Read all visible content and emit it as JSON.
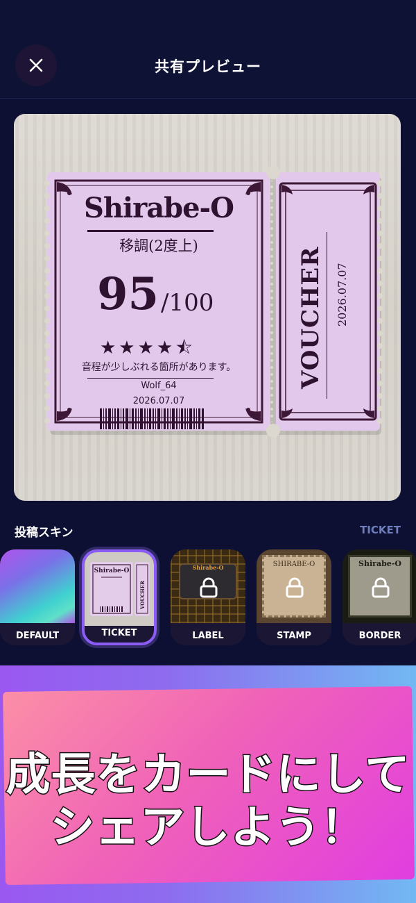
{
  "header": {
    "title": "共有プレビュー",
    "close_icon": "close-icon"
  },
  "ticket": {
    "brand": "Shirabe-O",
    "subtitle": "移調(2度上)",
    "score": "95",
    "score_total": "/100",
    "stars": "★★★★⯪",
    "comment": "音程が少しぶれる箇所があります。",
    "user": "Wolf_64",
    "date": "2026.07.07",
    "voucher_label": "VOUCHER",
    "voucher_date": "2026.07.07"
  },
  "skins": {
    "label": "投稿スキン",
    "current": "TICKET",
    "items": [
      {
        "name": "DEFAULT",
        "locked": false,
        "selected": false
      },
      {
        "name": "TICKET",
        "locked": false,
        "selected": true
      },
      {
        "name": "LABEL",
        "locked": true,
        "selected": false
      },
      {
        "name": "STAMP",
        "locked": true,
        "selected": false
      },
      {
        "name": "BORDER",
        "locked": true,
        "selected": false
      }
    ],
    "thumb_texts": {
      "ticket_brand": "Shirabe-O",
      "ticket_voucher": "VOUCHER",
      "label_brand": "Shirabe-O",
      "stamp_brand": "SHIRABE-O",
      "border_brand": "Shirabe-O"
    }
  },
  "banner": {
    "line1": "成長をカードにして",
    "line2": "シェアしよう！"
  },
  "colors": {
    "background": "#0d1033",
    "ticket": "#e2c9ec",
    "ink": "#2e1230",
    "accent": "#8b5cf6",
    "skin_current": "#6f7ebd"
  }
}
